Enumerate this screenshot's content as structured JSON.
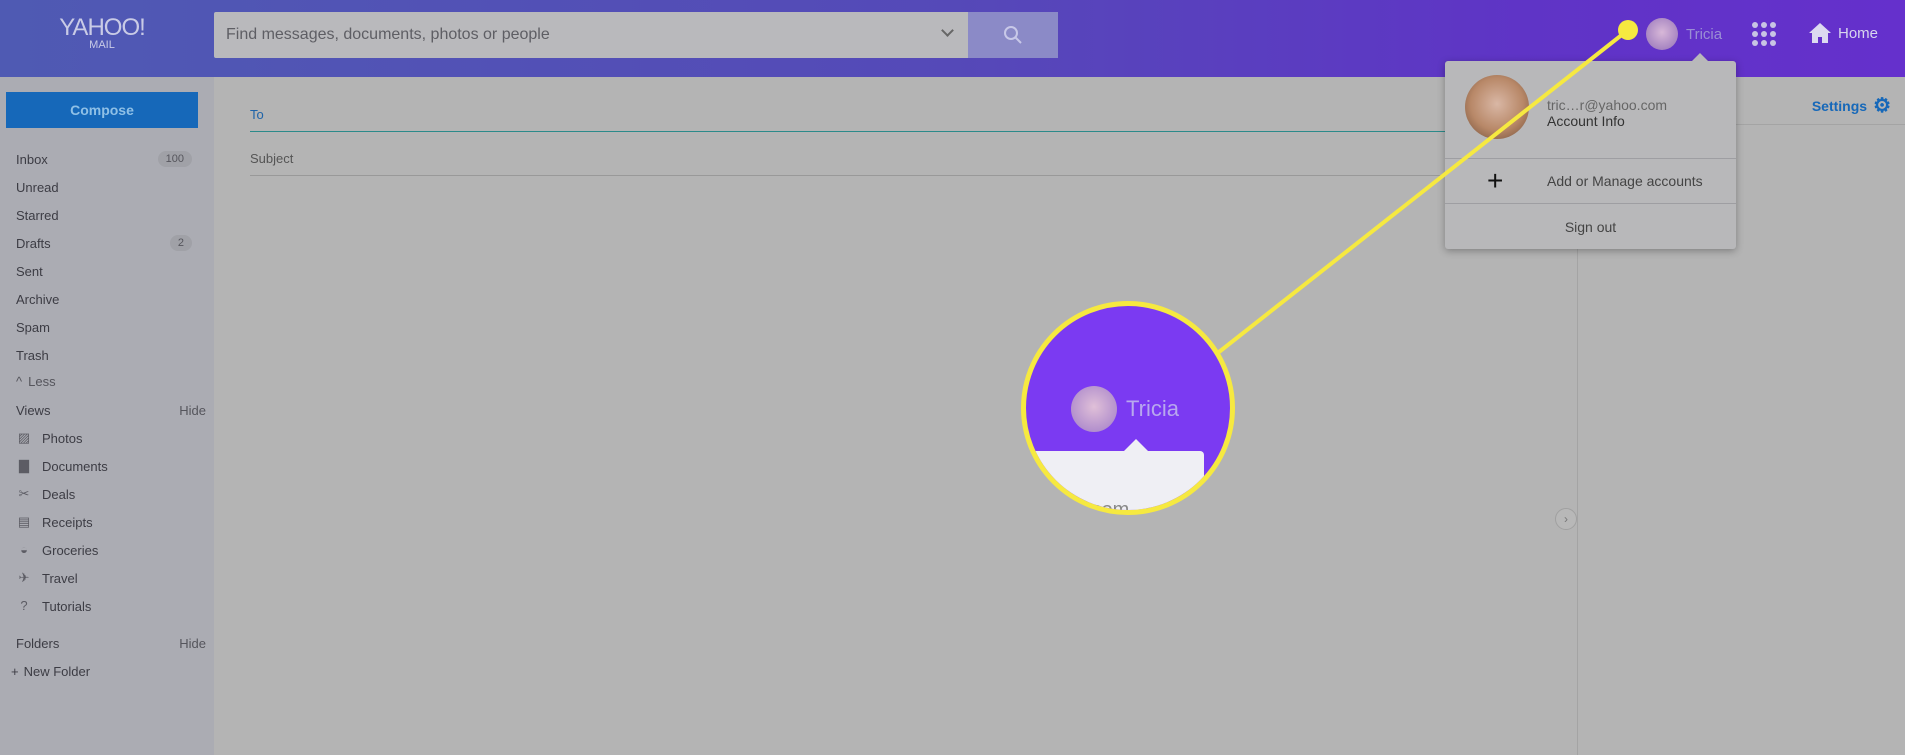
{
  "header": {
    "logo": "YAHOO!",
    "logo_sub": "MAIL",
    "search_placeholder": "Find messages, documents, photos or people",
    "user_name": "Tricia",
    "home_label": "Home"
  },
  "sidebar": {
    "compose": "Compose",
    "folders": [
      {
        "label": "Inbox",
        "badge": "100"
      },
      {
        "label": "Unread"
      },
      {
        "label": "Starred"
      },
      {
        "label": "Drafts",
        "badge": "2"
      },
      {
        "label": "Sent"
      },
      {
        "label": "Archive"
      },
      {
        "label": "Spam"
      },
      {
        "label": "Trash"
      }
    ],
    "less": "Less",
    "views_title": "Views",
    "views_hide": "Hide",
    "views": [
      {
        "label": "Photos",
        "icon": "photo-icon"
      },
      {
        "label": "Documents",
        "icon": "document-icon"
      },
      {
        "label": "Deals",
        "icon": "scissors-icon"
      },
      {
        "label": "Receipts",
        "icon": "receipt-icon"
      },
      {
        "label": "Groceries",
        "icon": "basket-icon"
      },
      {
        "label": "Travel",
        "icon": "plane-icon"
      },
      {
        "label": "Tutorials",
        "icon": "help-icon"
      }
    ],
    "folders_title": "Folders",
    "folders_hide": "Hide",
    "new_folder": "New Folder"
  },
  "compose_form": {
    "to_label": "To",
    "subject_label": "Subject"
  },
  "right_panel": {
    "settings": "Settings"
  },
  "account_menu": {
    "email": "tric…r@yahoo.com",
    "account_info": "Account Info",
    "add_manage": "Add or Manage accounts",
    "sign_out": "Sign out"
  },
  "callout": {
    "name": "Tricia",
    "email_fragment": ".com",
    "color": "#f6e940"
  },
  "colors": {
    "accent": "#1668b9",
    "header_start": "#4f5ab3",
    "header_end": "#6530cc"
  }
}
